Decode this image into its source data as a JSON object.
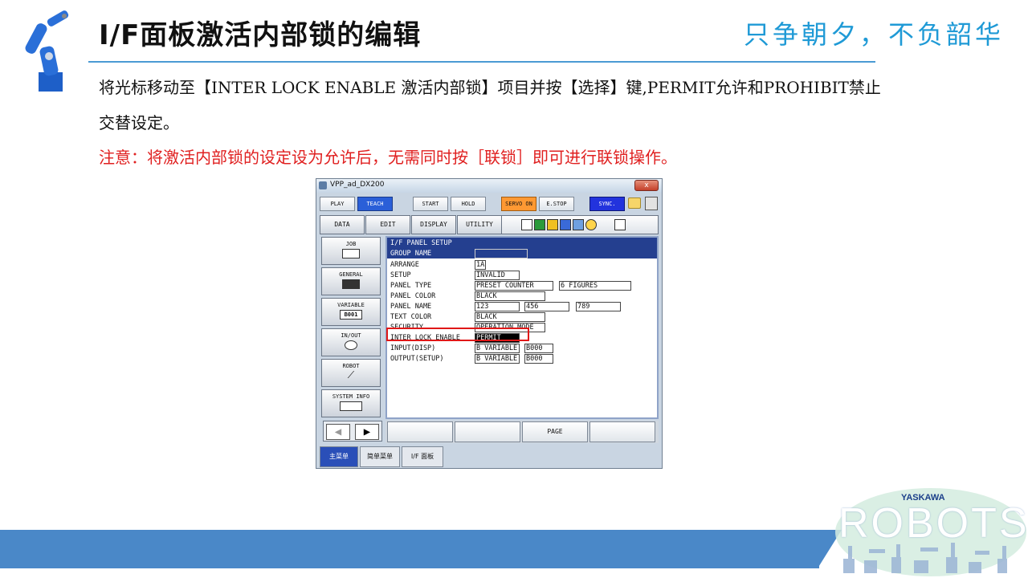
{
  "slide": {
    "title": "I/F面板激活内部锁的编辑",
    "slogan": "只争朝夕，不负韶华",
    "para_line1": "将光标移动至【INTER LOCK ENABLE 激活内部锁】项目并按【选择】键,PERMIT允许和PROHIBIT禁止",
    "para_line2": "交替设定。",
    "note": "注意：将激活内部锁的设定设为允许后，无需同时按［联锁］即可进行联锁操作。"
  },
  "window": {
    "title": "VPP_ad_DX200",
    "close": "x",
    "status": {
      "play": "PLAY",
      "teach": "TEACH",
      "start": "START",
      "hold": "HOLD",
      "servo_on": "SERVO ON",
      "estop": "E.STOP",
      "sync": "SYNC."
    },
    "menu": {
      "data": "DATA",
      "edit": "EDIT",
      "display": "DISPLAY",
      "utility": "UTILITY"
    },
    "left_menu": [
      {
        "label": "JOB"
      },
      {
        "label": "GENERAL"
      },
      {
        "label": "VARIABLE",
        "sub": "B001"
      },
      {
        "label": "IN/OUT"
      },
      {
        "label": "ROBOT"
      },
      {
        "label": "SYSTEM INFO"
      }
    ],
    "screen": {
      "header": "I/F PANEL SETUP",
      "rows": [
        {
          "label": "GROUP NAME",
          "v1": ""
        },
        {
          "label": "ARRANGE",
          "v1": "1A"
        },
        {
          "label": "SETUP",
          "v1": "INVALID"
        },
        {
          "label": "PANEL TYPE",
          "v1": "PRESET COUNTER",
          "v2": "6 FIGURES"
        },
        {
          "label": "PANEL COLOR",
          "v1": "BLACK"
        },
        {
          "label": "PANEL NAME",
          "v1": "123",
          "v2": "456",
          "v3": "789"
        },
        {
          "label": "TEXT COLOR",
          "v1": "BLACK"
        },
        {
          "label": "SECURITY",
          "v1": "OPERATION MODE"
        },
        {
          "label": "INTER LOCK ENABLE",
          "v1": "PERMIT"
        },
        {
          "label": "INPUT(DISP)",
          "v1": "B VARIABLE",
          "v2": "B000"
        },
        {
          "label": "OUTPUT(SETUP)",
          "v1": "B VARIABLE",
          "v2": "B000"
        }
      ]
    },
    "bottom": {
      "page": "PAGE"
    },
    "tabs": {
      "main_menu": "主菜单",
      "simple_menu": "简单菜单",
      "if_panel": "I/F 面板"
    }
  },
  "footer": {
    "brand": "YASKAWA",
    "robots": "ROBOTS"
  },
  "colors": {
    "accent_blue": "#4a88c8",
    "slogan_blue": "#1f9ad6",
    "note_red": "#e02020",
    "highlight_red": "#e01818"
  }
}
